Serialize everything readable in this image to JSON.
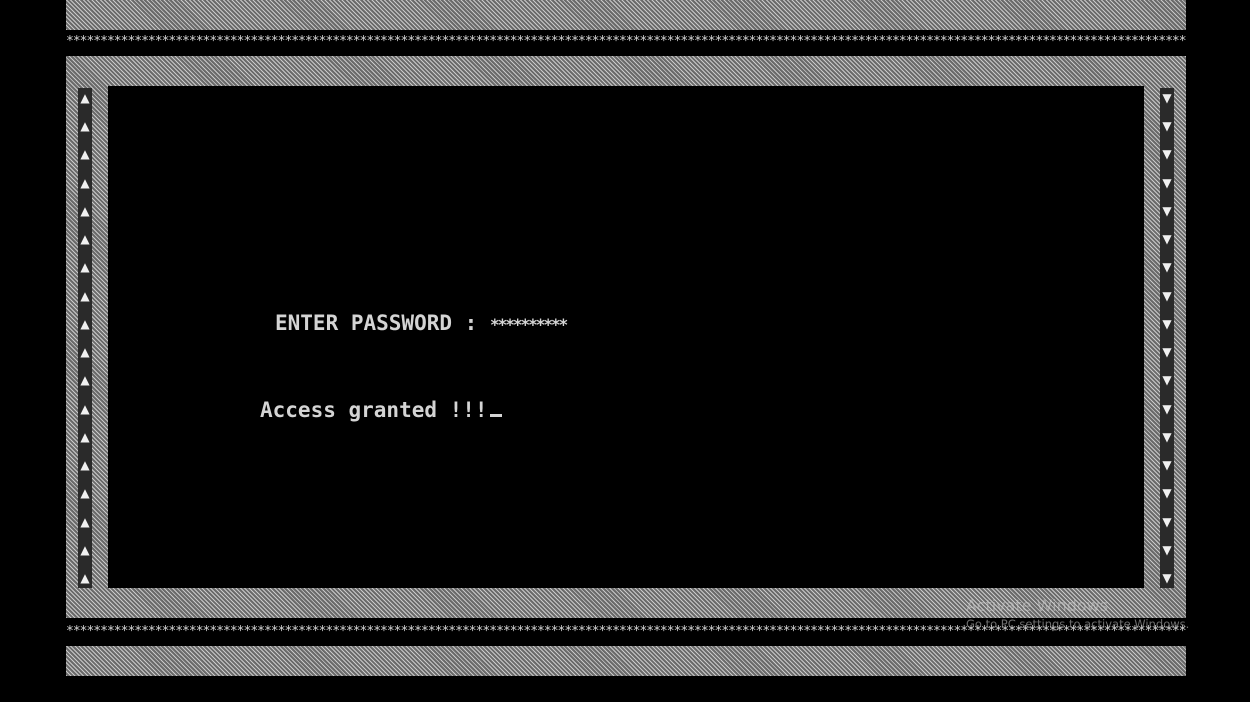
{
  "prompt": {
    "label": "ENTER PASSWORD :",
    "masked_value": "**********"
  },
  "result": {
    "message": "Access granted !!!"
  },
  "border": {
    "star_row": "**************************************************************************************************************************************************************************",
    "left_arrow": "▲",
    "right_arrow": "▼",
    "left_arrow_icon": "up-triangle-icon",
    "right_arrow_icon": "down-triangle-icon"
  },
  "watermark": {
    "title": "Activate Windows",
    "subtitle": "Go to PC settings to activate Windows."
  },
  "colors": {
    "background": "#000000",
    "text": "#d4d4d4",
    "hatch_light": "#c9c9c9",
    "hatch_dark": "#6a6a6a"
  }
}
